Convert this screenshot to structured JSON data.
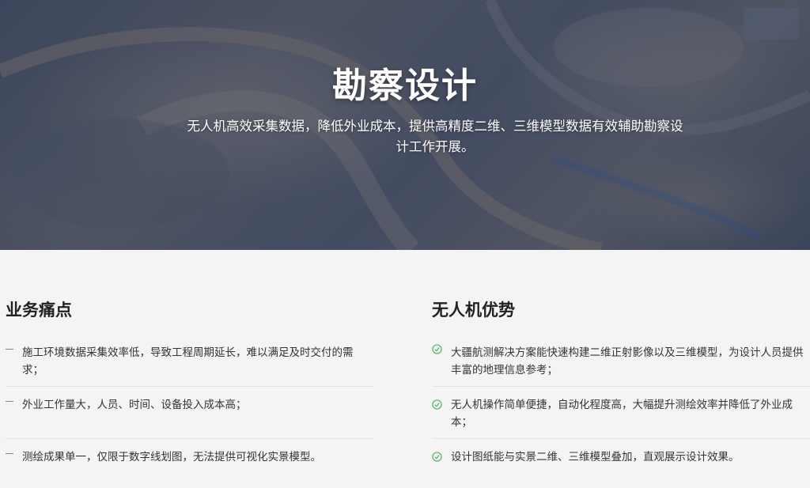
{
  "hero": {
    "title": "勘察设计",
    "description": "无人机高效采集数据，降低外业成本，提供高精度二维、三维模型数据有效辅助勘察设计工作开展。"
  },
  "pain_points": {
    "title": "业务痛点",
    "items": [
      "施工环境数据采集效率低，导致工程周期延长，难以满足及时交付的需求；",
      "外业工作量大，人员、时间、设备投入成本高；",
      "测绘成果单一，仅限于数字线划图，无法提供可视化实景模型。"
    ]
  },
  "advantages": {
    "title": "无人机优势",
    "items": [
      "大疆航测解决方案能快速构建二维正射影像以及三维模型，为设计人员提供丰富的地理信息参考；",
      "无人机操作简单便捷，自动化程度高，大幅提升测绘效率并降低了外业成本；",
      "设计图纸能与实景二维、三维模型叠加，直观展示设计效果。"
    ]
  },
  "colors": {
    "check_green": "#52b36b",
    "dash_gray": "#888888"
  },
  "icons": {
    "pain_point_marker": "dash-icon",
    "advantage_marker": "check-circle-icon"
  }
}
